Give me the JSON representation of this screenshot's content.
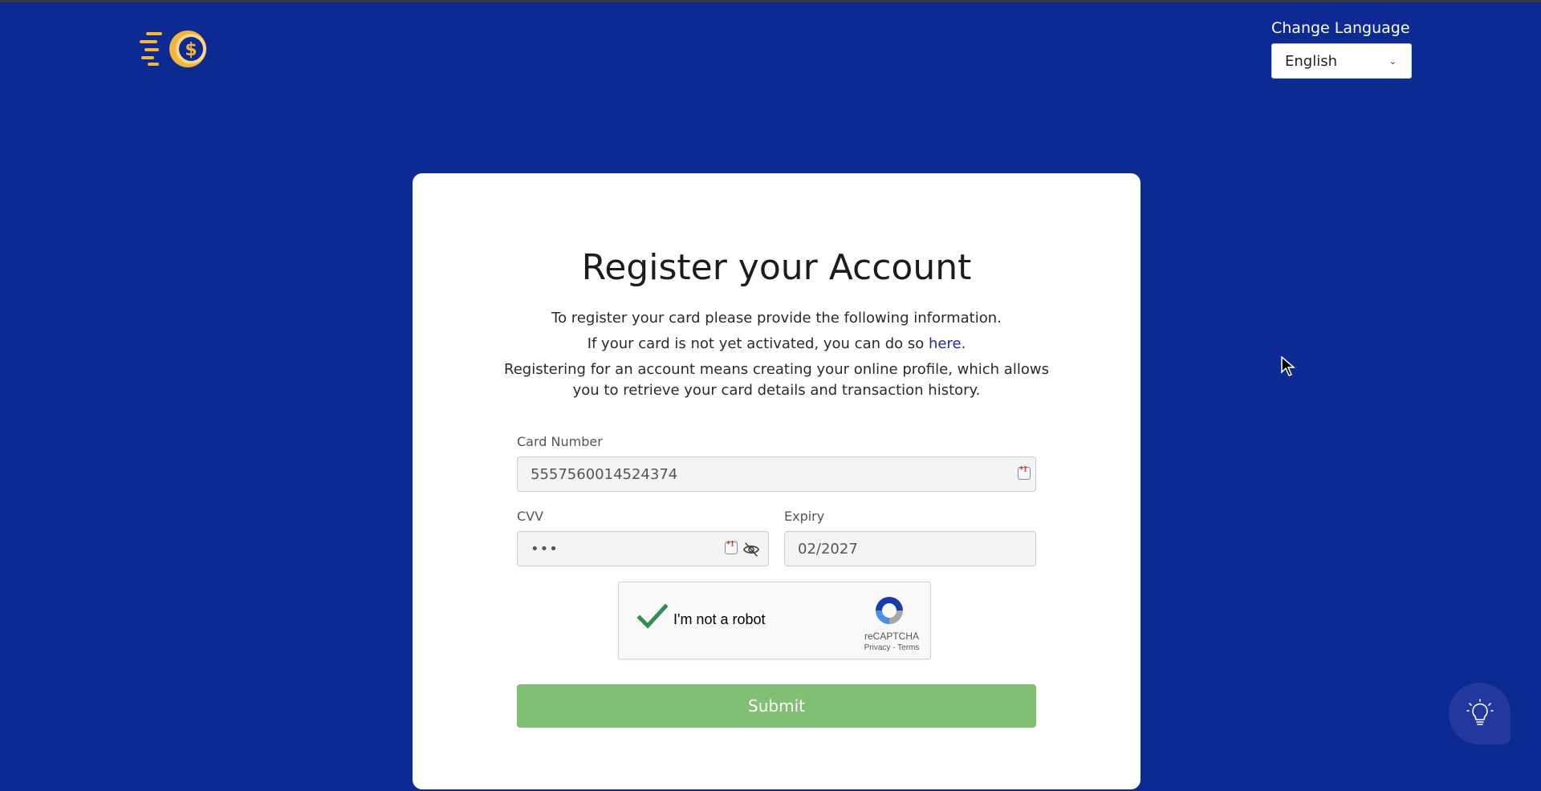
{
  "header": {
    "logo_icon": "dollar-coin-speed-icon",
    "change_language_label": "Change Language",
    "language_selected": "English"
  },
  "form": {
    "title": "Register your Account",
    "intro_line1": "To register your card please provide the following information.",
    "intro_line2_prefix": "If your card is not yet activated, you can do so ",
    "intro_line2_link": "here",
    "intro_line2_suffix": ".",
    "intro_line3": "Registering for an account means creating your online profile, which allows you to retrieve your card details and transaction history.",
    "card_number_label": "Card Number",
    "card_number_value": "5557560014524374",
    "cvv_label": "CVV",
    "cvv_value": "•••",
    "expiry_label": "Expiry",
    "expiry_value": "02/2027",
    "submit_label": "Submit"
  },
  "captcha": {
    "label": "I'm not a robot",
    "brand": "reCAPTCHA",
    "links": "Privacy - Terms",
    "checked": true
  },
  "colors": {
    "background": "#0c2a91",
    "card": "#ffffff",
    "submit": "#81bf74",
    "link": "#1a2bb7",
    "logo_gold": "#f2b63c"
  },
  "hint_button_icon": "lightbulb-icon"
}
